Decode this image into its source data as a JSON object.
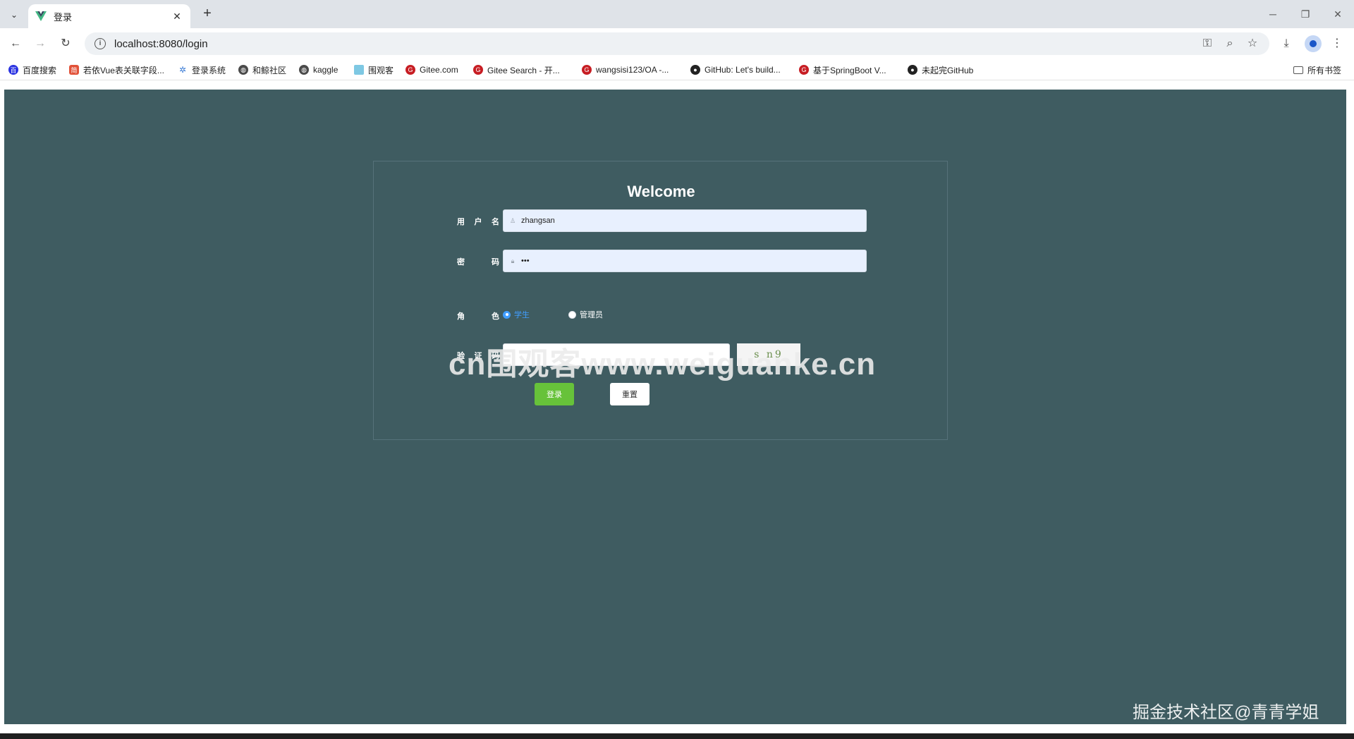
{
  "browser": {
    "tab": {
      "title": "登录"
    },
    "address_bar": {
      "url": "localhost:8080/login"
    }
  },
  "bookmarks": [
    {
      "label": "百度搜索",
      "icon": "baidu-icon"
    },
    {
      "label": "若依Vue表关联字段...",
      "icon": "ruoyi-icon"
    },
    {
      "label": "登录系统",
      "icon": "login-icon"
    },
    {
      "label": "和鲸社区",
      "icon": "globe-icon"
    },
    {
      "label": "kaggle",
      "icon": "globe-icon"
    },
    {
      "label": "围观客",
      "icon": "weiguan-icon"
    },
    {
      "label": "Gitee.com",
      "icon": "gitee-icon"
    },
    {
      "label": "Gitee Search - 开...",
      "icon": "gitee-icon"
    },
    {
      "label": "wangsisi123/OA -...",
      "icon": "gitee-icon"
    },
    {
      "label": "GitHub: Let's build...",
      "icon": "github-icon"
    },
    {
      "label": "基于SpringBoot V...",
      "icon": "gitee-icon"
    },
    {
      "label": "未起完GitHub",
      "icon": "github-icon"
    },
    {
      "label": "所有书签",
      "icon": "folder-icon"
    }
  ],
  "login": {
    "title": "Welcome",
    "username_label": [
      "用",
      "户",
      "名"
    ],
    "username_value": "zhangsan",
    "password_label": [
      "密",
      "码"
    ],
    "password_value": "•••",
    "role_label": [
      "角",
      "色"
    ],
    "roles": [
      {
        "label": "学生",
        "selected": true
      },
      {
        "label": "管理员",
        "selected": false
      }
    ],
    "captcha_label": [
      "验",
      "证",
      "码"
    ],
    "captcha_text": "s n9",
    "login_button": "登录",
    "reset_button": "重置"
  },
  "watermarks": {
    "center": "cn围观客www.weiguanke.cn",
    "corner": "掘金技术社区@青青学姐"
  },
  "colors": {
    "page_bg": "#3f5c61",
    "login_button": "#67c23a",
    "selected_radio": "#409eff"
  }
}
